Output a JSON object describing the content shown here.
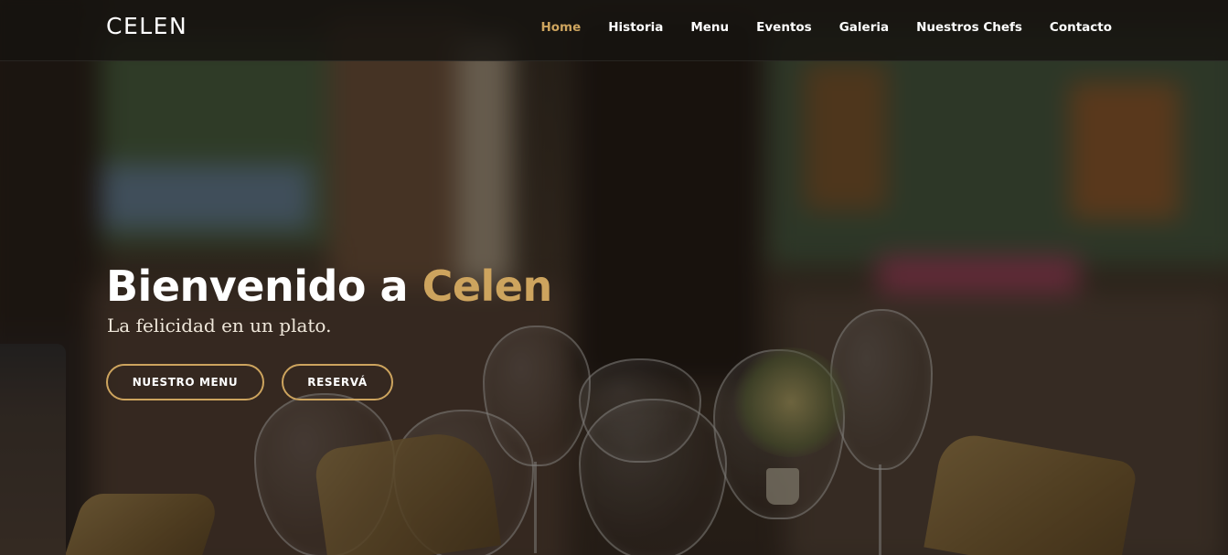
{
  "brand": {
    "logo": "CELEN"
  },
  "nav": {
    "items": [
      {
        "label": "Home",
        "active": true
      },
      {
        "label": "Historia",
        "active": false
      },
      {
        "label": "Menu",
        "active": false
      },
      {
        "label": "Eventos",
        "active": false
      },
      {
        "label": "Galeria",
        "active": false
      },
      {
        "label": "Nuestros Chefs",
        "active": false
      },
      {
        "label": "Contacto",
        "active": false
      }
    ]
  },
  "hero": {
    "title_prefix": "Bienvenido a ",
    "title_highlight": "Celen",
    "subtitle": "La felicidad en un plato.",
    "buttons": {
      "menu_label": "NUESTRO MENU",
      "book_label": "RESERVÁ"
    }
  },
  "colors": {
    "accent": "#cda45e",
    "header_bg": "#16140f",
    "text": "#ffffff"
  }
}
